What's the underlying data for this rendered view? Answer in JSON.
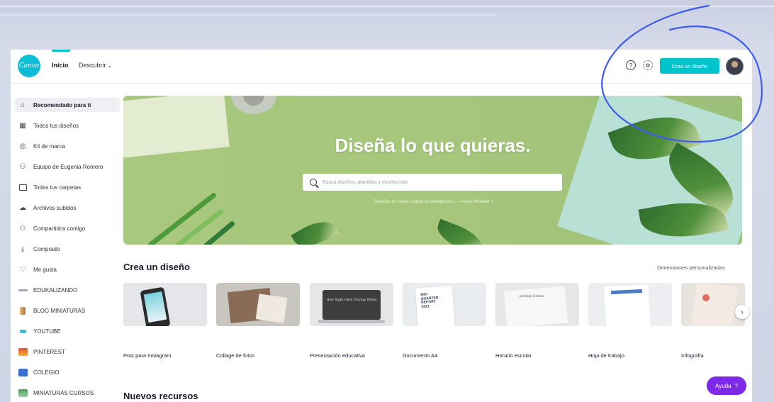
{
  "header": {
    "logo": "Canva",
    "nav_inicio": "Inicio",
    "nav_descubrir": "Descubrir",
    "create_button": "Crea un diseño",
    "help_icon_glyph": "?"
  },
  "sidebar": {
    "items": [
      {
        "label": "Recomendado para ti",
        "icon": "home-icon"
      },
      {
        "label": "Todos tus diseños",
        "icon": "grid-icon"
      },
      {
        "label": "Kit de marca",
        "icon": "brand-kit-icon"
      },
      {
        "label": "Equipo de Eugenia Romero",
        "icon": "team-icon"
      },
      {
        "label": "Todas tus carpetas",
        "icon": "folder-icon"
      },
      {
        "label": "Archivos subidos",
        "icon": "cloud-upload-icon"
      },
      {
        "label": "Compartidos contigo",
        "icon": "shared-icon"
      },
      {
        "label": "Comprado",
        "icon": "download-icon"
      },
      {
        "label": "Me gusta",
        "icon": "heart-icon"
      },
      {
        "label": "EDUKALIZANDO",
        "icon": "folder-thumb-icon"
      },
      {
        "label": "BLOG MINIATURAS",
        "icon": "folder-thumb-icon"
      },
      {
        "label": "YOUTUBE",
        "icon": "folder-thumb-icon"
      },
      {
        "label": "PINTEREST",
        "icon": "folder-thumb-icon"
      },
      {
        "label": "COLEGIO",
        "icon": "folder-thumb-icon"
      },
      {
        "label": "MINIATURAS CURSOS",
        "icon": "folder-thumb-icon"
      }
    ]
  },
  "hero": {
    "title": "Diseña lo que quieras.",
    "search_placeholder": "Busca diseños, plantillas y mucho más",
    "quote": "\"Diseñar es hacer visible la inteligencia\". —Alina Wheeler ›"
  },
  "create_section": {
    "title": "Crea un diseño",
    "custom_dimensions": "Dimensiones personalizadas",
    "cards": [
      {
        "label": "Post para Instagram"
      },
      {
        "label": "Collage de fotos"
      },
      {
        "label": "Presentación educativa",
        "thumb_text": "How Sight Hard Driving Works"
      },
      {
        "label": "Documento A4",
        "thumb_text": "MID-QUARTER REPORT 2021"
      },
      {
        "label": "Horario escolar",
        "thumb_text": "Jordon Green"
      },
      {
        "label": "Hoja de trabajo"
      },
      {
        "label": "Infografía"
      }
    ],
    "next_glyph": "›"
  },
  "resources_section": {
    "title": "Nuevos recursos"
  },
  "help_button": {
    "label": "Ayuda",
    "glyph": "?"
  },
  "colors": {
    "accent": "#00c4cc",
    "help": "#7d2ae8",
    "annotation": "#3d5af1"
  }
}
